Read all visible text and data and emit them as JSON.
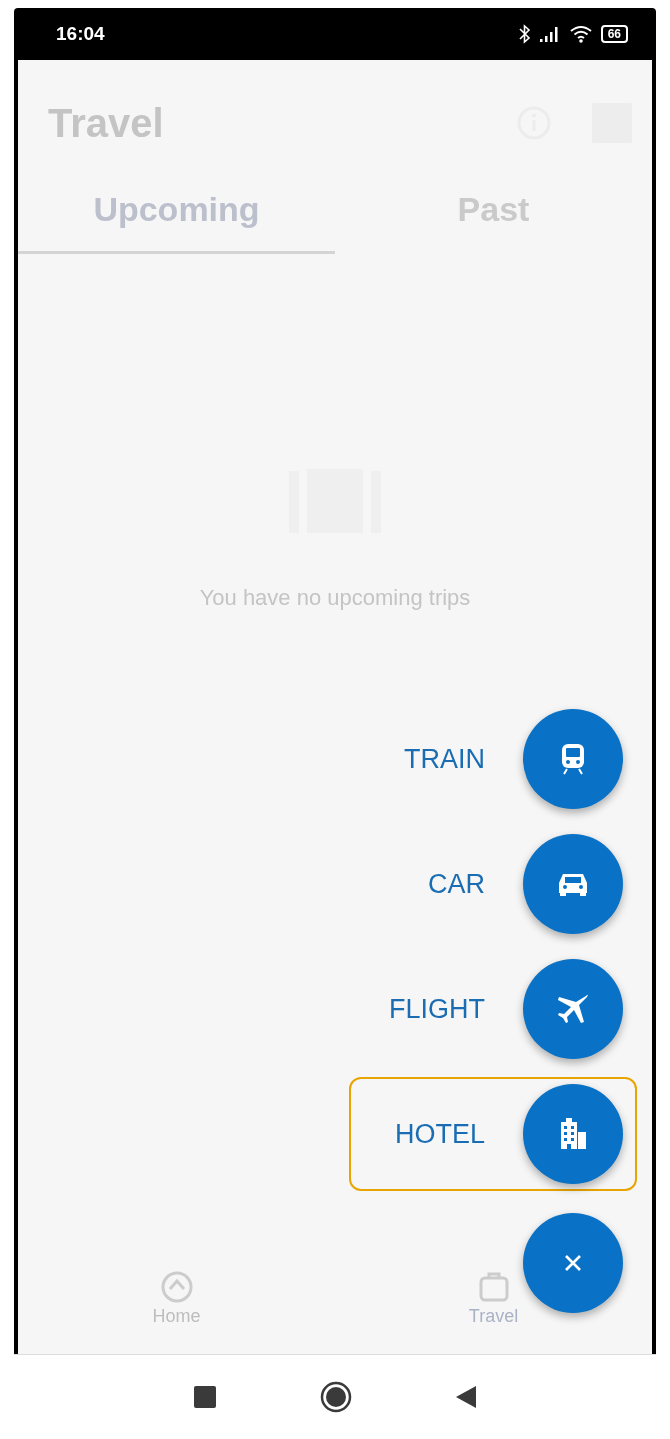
{
  "status_bar": {
    "time": "16:04",
    "battery": "66"
  },
  "header": {
    "title": "Travel"
  },
  "tabs": [
    {
      "label": "Upcoming",
      "selected": true
    },
    {
      "label": "Past",
      "selected": false
    }
  ],
  "empty_state": {
    "message": "You have no upcoming trips"
  },
  "bottom_nav": [
    {
      "label": "Home",
      "kind": "home",
      "selected": false
    },
    {
      "label": "Travel",
      "kind": "travel",
      "selected": true
    }
  ],
  "fab_menu": {
    "items": [
      {
        "label": "TRAIN",
        "kind": "train",
        "focused": false
      },
      {
        "label": "CAR",
        "kind": "car",
        "focused": false
      },
      {
        "label": "FLIGHT",
        "kind": "flight",
        "focused": false
      },
      {
        "label": "HOTEL",
        "kind": "hotel",
        "focused": true
      }
    ]
  }
}
